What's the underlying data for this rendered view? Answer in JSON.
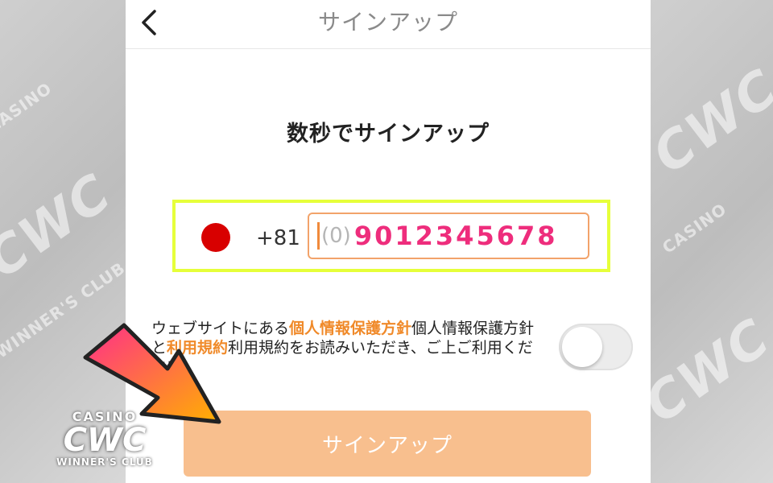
{
  "header": {
    "title": "サインアップ"
  },
  "main": {
    "heading": "数秒でサインアップ",
    "phone": {
      "country_code": "+81",
      "prefix": "(0)",
      "number": "9012345678"
    },
    "terms": {
      "text_1": "ウェブサイトにある",
      "link_privacy": "個人情報保護方針",
      "text_2": "個人情報保護方針と",
      "link_terms": "利用規約",
      "text_3": "利用規約をお読みいただき、ご上ご利用ください。"
    },
    "toggle_on": false,
    "signup_button": "サインアップ"
  },
  "watermark": {
    "casino": "CASINO",
    "brand": "CWC",
    "sub": "WINNER'S CLUB"
  },
  "colors": {
    "accent": "#f08a2a",
    "number": "#ee2d7c",
    "button": "#f8bf8e",
    "highlight": "#e6ff3a",
    "flag_red": "#d80000"
  }
}
